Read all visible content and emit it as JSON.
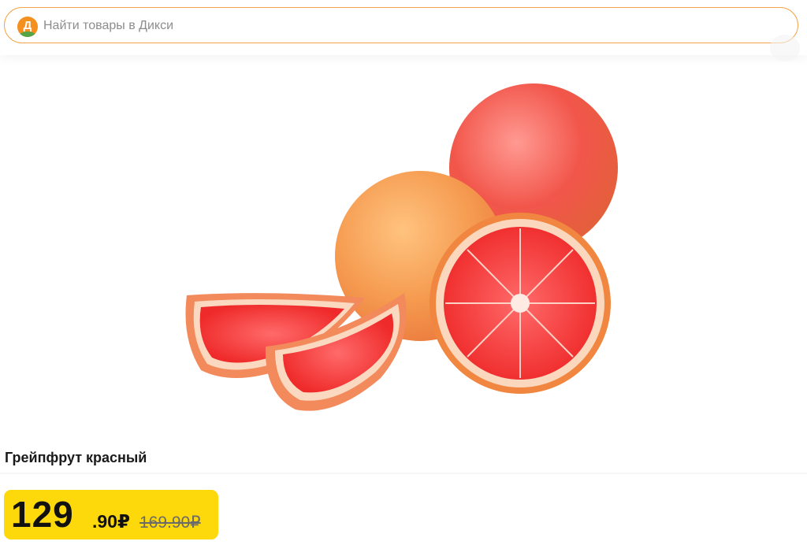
{
  "search": {
    "placeholder": "Найти товары в Дикси",
    "logo_letter": "Д",
    "brand_colors": {
      "orange": "#f39020",
      "green": "#55a546"
    }
  },
  "product": {
    "title": "Грейпфрут красный",
    "image_icon": "grapefruit-image"
  },
  "price": {
    "integer": "129",
    "fraction": ".90₽",
    "old": "169.90₽",
    "badge_color": "#fdd80a"
  }
}
